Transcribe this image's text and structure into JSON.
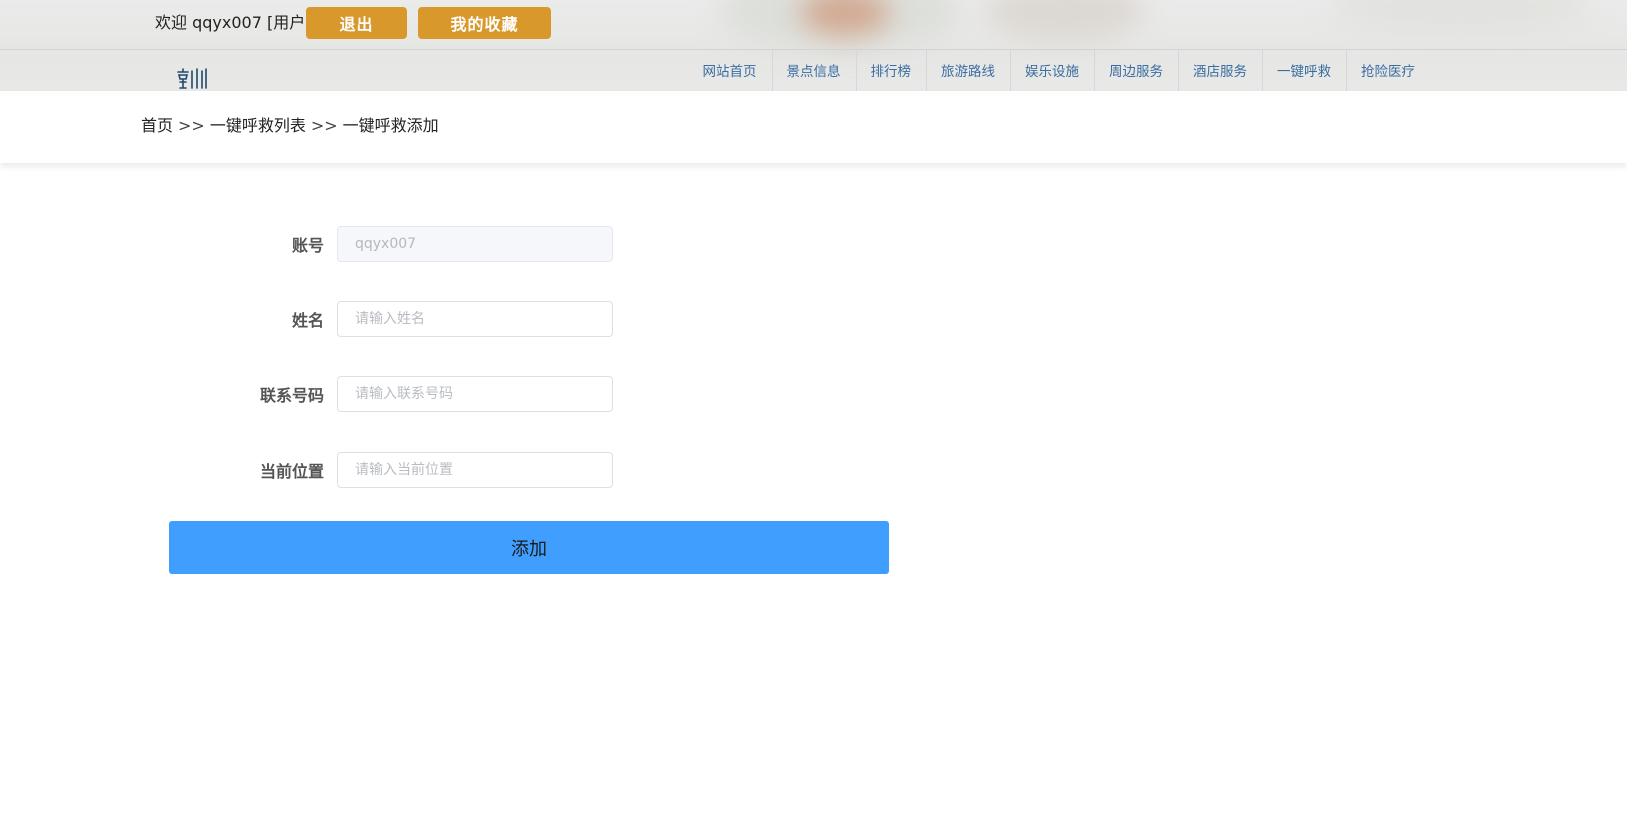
{
  "header": {
    "welcome_text": "欢迎 qqyx007 [用户]",
    "logout_label": "退出",
    "favorites_label": "我的收藏",
    "accent_color": "#d9982b"
  },
  "logo": {
    "icon": "site-logo"
  },
  "nav": {
    "items": [
      {
        "label": "网站首页"
      },
      {
        "label": "景点信息"
      },
      {
        "label": "排行榜"
      },
      {
        "label": "旅游路线"
      },
      {
        "label": "娱乐设施"
      },
      {
        "label": "周边服务"
      },
      {
        "label": "酒店服务"
      },
      {
        "label": "一键呼救"
      },
      {
        "label": "抢险医疗"
      }
    ]
  },
  "breadcrumb": {
    "home": "首页",
    "separator": ">>",
    "list": "一键呼救列表",
    "sep2": ">>",
    "current": "一键呼救添加"
  },
  "form": {
    "account": {
      "label": "账号",
      "value": "qqyx007",
      "disabled": true
    },
    "name": {
      "label": "姓名",
      "placeholder": "请输入姓名",
      "value": ""
    },
    "phone": {
      "label": "联系号码",
      "placeholder": "请输入联系号码",
      "value": ""
    },
    "location": {
      "label": "当前位置",
      "placeholder": "请输入当前位置",
      "value": ""
    },
    "submit_label": "添加",
    "submit_color": "#409eff"
  }
}
